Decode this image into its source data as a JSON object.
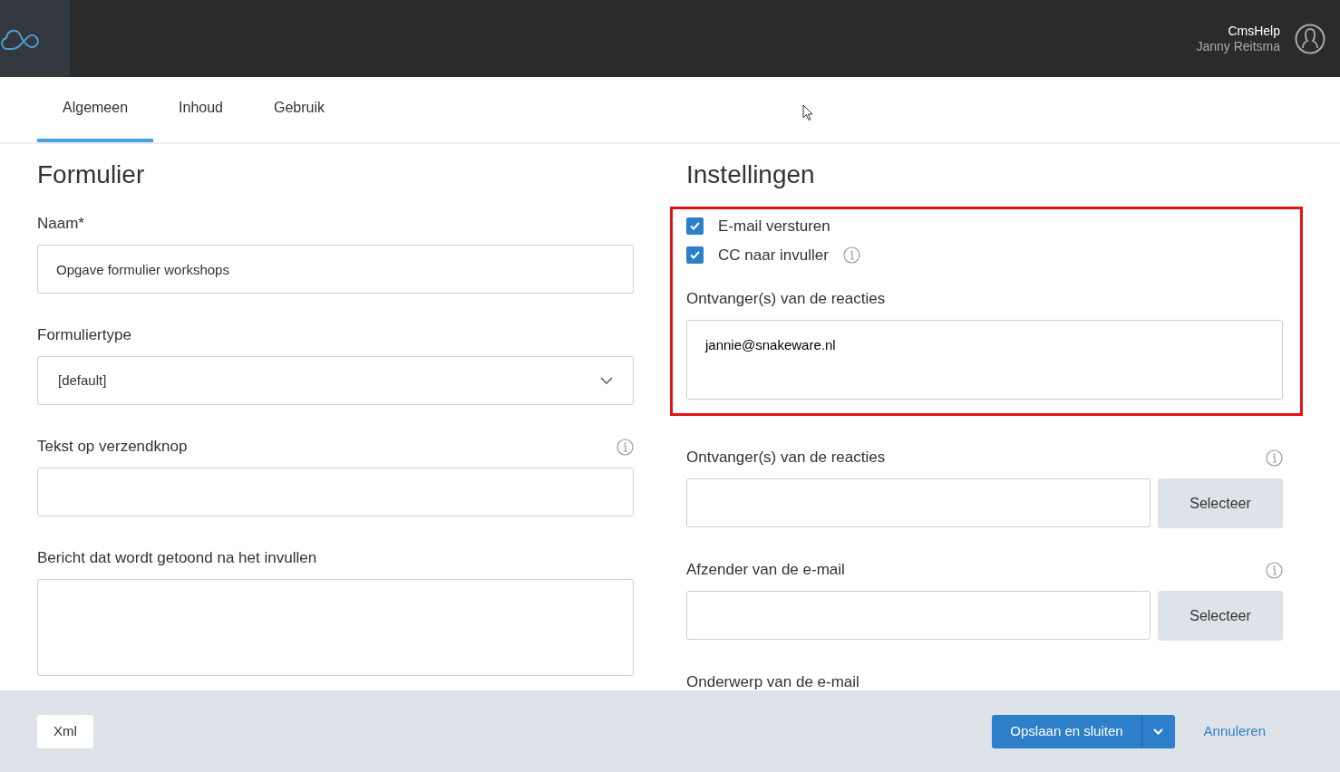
{
  "header": {
    "app_title": "CmsHelp",
    "user_name": "Janny Reitsma"
  },
  "tabs": [
    {
      "label": "Algemeen",
      "selected": true
    },
    {
      "label": "Inhoud",
      "selected": false
    },
    {
      "label": "Gebruik",
      "selected": false
    }
  ],
  "left_panel": {
    "title": "Formulier",
    "fields": [
      {
        "label": "Naam*",
        "kind": "text",
        "value": "Opgave formulier workshops"
      },
      {
        "label": "Formuliertype",
        "kind": "select",
        "value": "[default]"
      },
      {
        "label": "Tekst op verzendknop",
        "kind": "text",
        "info": true
      },
      {
        "label": "Bericht dat wordt getoond na het invullen",
        "kind": "textarea"
      }
    ]
  },
  "right_panel": {
    "title": "Instellingen",
    "highlighted_group": {
      "checkboxes": [
        {
          "label": "E-mail versturen",
          "checked": true
        },
        {
          "label": "CC naar invuller",
          "checked": true,
          "info": true
        }
      ],
      "fields": [
        {
          "label": "Ontvanger(s) van de reacties",
          "kind": "textarea",
          "value": "jannie@snakeware.nl"
        }
      ]
    },
    "fields": [
      {
        "label": "Ontvanger(s) van de reacties",
        "kind": "picker",
        "button": "Selecteer",
        "info": true
      },
      {
        "label": "Afzender van de e-mail",
        "kind": "picker",
        "button": "Selecteer",
        "info": true
      },
      {
        "label": "Onderwerp van de e-mail",
        "kind": "label_only"
      }
    ]
  },
  "footer": {
    "xml_button": "Xml",
    "save_button": "Opslaan en sluiten",
    "cancel_link": "Annuleren"
  }
}
